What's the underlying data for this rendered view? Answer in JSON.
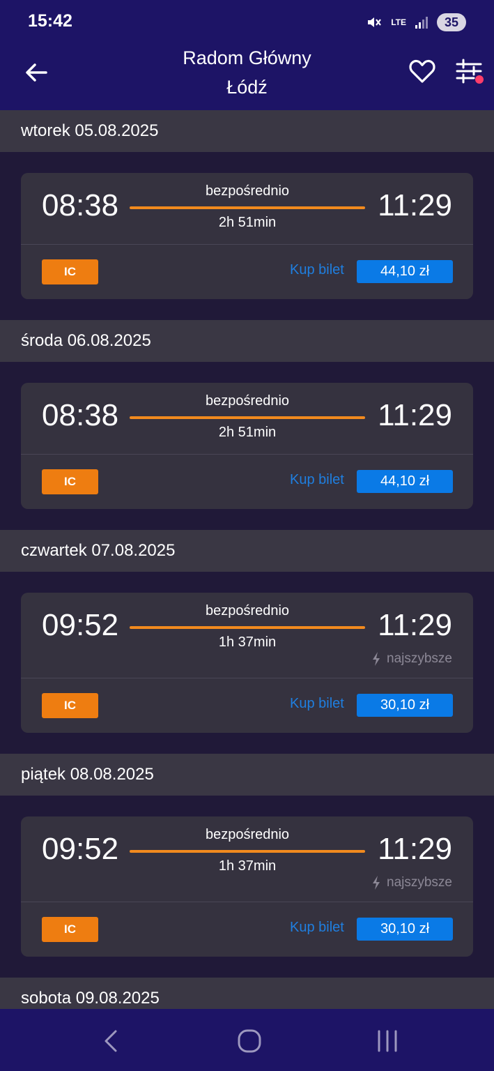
{
  "status_bar": {
    "time": "15:42",
    "network": "LTE",
    "battery": "35",
    "icons": [
      "mute-icon",
      "lte-icon",
      "signal-icon",
      "battery-icon"
    ]
  },
  "header": {
    "from": "Radom Główny",
    "to": "Łódź",
    "icons": [
      "back-arrow-icon",
      "heart-icon",
      "filter-sliders-icon"
    ],
    "colors": {
      "background": "#1d1466",
      "filter_dot": "#ff3d6a"
    }
  },
  "days": [
    {
      "date_label": "wtorek  05.08.2025",
      "connection": {
        "departure": "08:38",
        "arrival": "11:29",
        "type": "bezpośrednio",
        "duration": "2h 51min",
        "fastest": false,
        "carrier": "IC",
        "buy_label": "Kup bilet",
        "price": "44,10 zł"
      }
    },
    {
      "date_label": "środa  06.08.2025",
      "connection": {
        "departure": "08:38",
        "arrival": "11:29",
        "type": "bezpośrednio",
        "duration": "2h 51min",
        "fastest": false,
        "carrier": "IC",
        "buy_label": "Kup bilet",
        "price": "44,10 zł"
      }
    },
    {
      "date_label": "czwartek  07.08.2025",
      "connection": {
        "departure": "09:52",
        "arrival": "11:29",
        "type": "bezpośrednio",
        "duration": "1h 37min",
        "fastest": true,
        "fastest_label": "najszybsze",
        "carrier": "IC",
        "buy_label": "Kup bilet",
        "price": "30,10 zł"
      }
    },
    {
      "date_label": "piątek  08.08.2025",
      "connection": {
        "departure": "09:52",
        "arrival": "11:29",
        "type": "bezpośrednio",
        "duration": "1h 37min",
        "fastest": true,
        "fastest_label": "najszybsze",
        "carrier": "IC",
        "buy_label": "Kup bilet",
        "price": "30,10 zł"
      }
    },
    {
      "date_label": "sobota  09.08.2025"
    }
  ],
  "colors": {
    "route_line": "#f18a1e",
    "carrier_badge": "#ee7d11",
    "buy_link": "#1f7fe0",
    "price_button": "#0a7ae6",
    "card": "#35323f",
    "day_header": "#3a3744"
  },
  "nav_bar": {
    "icons": [
      "back-chevron-icon",
      "home-circle-icon",
      "recents-icon"
    ]
  }
}
